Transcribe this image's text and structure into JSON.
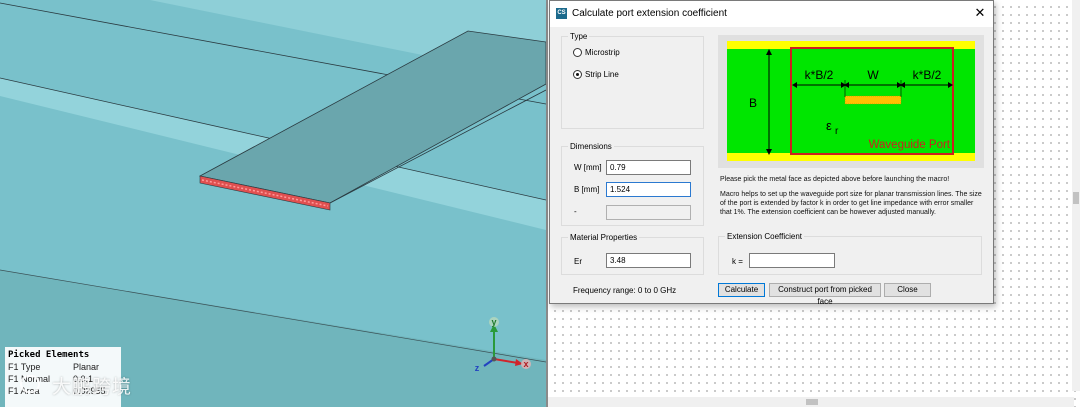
{
  "viewport": {
    "picked_elements": {
      "title": "Picked Elements",
      "rows": [
        {
          "key": "F1 Type",
          "value": "Planar"
        },
        {
          "key": "F1 Normal",
          "value": "0,0,1"
        },
        {
          "key": "F1 Area",
          "value": "0.02955"
        }
      ]
    },
    "axes": {
      "x": "x",
      "y": "y",
      "z": "z"
    },
    "watermark": "大鹏跨境",
    "colors": {
      "background": "#79c1cb",
      "floor": "#6fb7bf",
      "strip": "#5f9fa6",
      "port": "#e0201e",
      "axis_x": "#d0242b",
      "axis_y": "#2a9a3a",
      "axis_z": "#2242c0"
    }
  },
  "dialog": {
    "title": "Calculate port extension coefficient",
    "app_icon": "cst-app-icon",
    "close_label": "✕",
    "type_group": {
      "legend": "Type",
      "options": [
        {
          "label": "Microstrip",
          "selected": false
        },
        {
          "label": "Strip Line",
          "selected": true
        }
      ]
    },
    "dimensions_group": {
      "legend": "Dimensions",
      "w_label": "W [mm]",
      "w_value": "0.79",
      "b_label": "B [mm]",
      "b_value": "1.524",
      "extra_label": "-",
      "extra_value": ""
    },
    "material_group": {
      "legend": "Material Properties",
      "er_label": "Er",
      "er_value": "3.48"
    },
    "frequency_text": "Frequency range: 0 to 0 GHz",
    "picture": {
      "k_left": "k*B/2",
      "w": "W",
      "k_right": "k*B/2",
      "b": "B",
      "epsilon": "ε",
      "epsilon_sub": "r",
      "port": "Waveguide Port",
      "colors": {
        "dielectric": "#00e600",
        "metal": "#ffff00",
        "port": "#cc2020",
        "strip": "#ffc000"
      }
    },
    "instructions": [
      "Please pick the metal face as depicted above before launching the macro!",
      "Macro helps to set up the waveguide port size for planar transmission lines. The size of the port is extended by factor k in order to get line impedance with error smaller that 1%. The extension coefficient can be however adjusted manually."
    ],
    "extension_group": {
      "legend": "Extension Coefficient",
      "k_label": "k =",
      "k_value": ""
    },
    "buttons": {
      "calculate": "Calculate",
      "construct": "Construct port from picked face",
      "close": "Close"
    }
  }
}
